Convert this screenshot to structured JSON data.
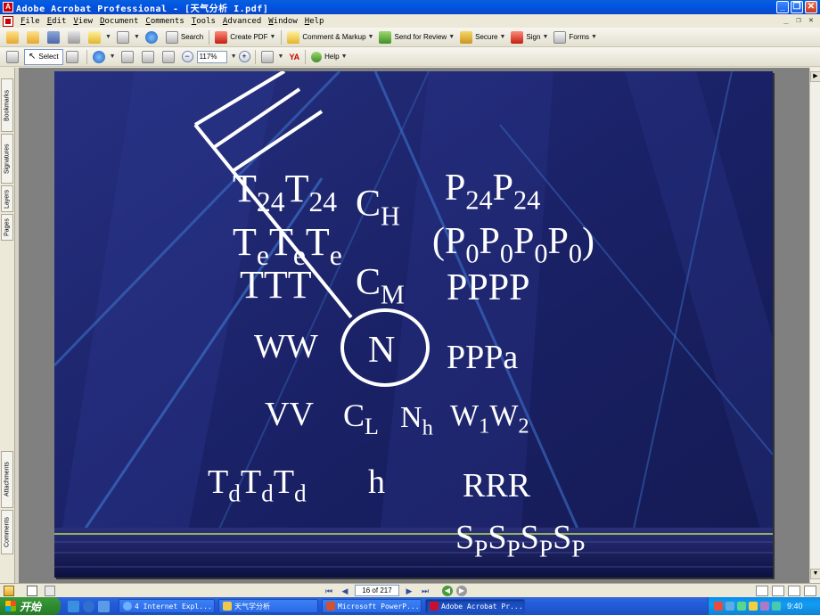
{
  "window": {
    "title": "Adobe Acrobat Professional - [天气分析 I.pdf]",
    "app_icon": "adobe-acrobat-icon"
  },
  "menu": [
    "File",
    "Edit",
    "View",
    "Document",
    "Comments",
    "Tools",
    "Advanced",
    "Window",
    "Help"
  ],
  "toolbar1": {
    "search": "Search",
    "create_pdf": "Create PDF",
    "comment_markup": "Comment & Markup",
    "send_review": "Send for Review",
    "secure": "Secure",
    "sign": "Sign",
    "forms": "Forms"
  },
  "toolbar2": {
    "select": "Select",
    "zoom": "117%",
    "help": "Help"
  },
  "nav_tabs": {
    "bookmarks": "Bookmarks",
    "signatures": "Signatures",
    "layers": "Layers",
    "pages": "Pages",
    "attachments": "Attachments",
    "comments": "Comments"
  },
  "slide": {
    "background": "#1c2366",
    "symbols": {
      "t24": {
        "base": "T",
        "sub": "24",
        "repeat": 2
      },
      "ch": {
        "base": "C",
        "sub": "H"
      },
      "p24": {
        "base": "P",
        "sub": "24",
        "repeat": 2
      },
      "te": {
        "base": "T",
        "sub": "e",
        "repeat": 3
      },
      "p0": {
        "open": "(",
        "base": "P",
        "sub": "0",
        "repeat": 4,
        "close": ")"
      },
      "ttt": "TTT",
      "cm": {
        "base": "C",
        "sub": "M"
      },
      "pppp": "PPPP",
      "ww": "WW",
      "n": "N",
      "pppa": "PPPa",
      "vv": "VV",
      "cl": {
        "base": "C",
        "sub": "L"
      },
      "nh": {
        "base": "N",
        "sub": "h"
      },
      "w1": {
        "base": "W",
        "sub": "1"
      },
      "w2": {
        "base": "W",
        "sub": "2"
      },
      "td": {
        "base": "T",
        "sub": "d",
        "repeat": 3
      },
      "h": "h",
      "rrr": "RRR",
      "sp": {
        "base": "S",
        "sub": "P",
        "repeat": 4
      }
    }
  },
  "status": {
    "page_indicator": "16 of 217"
  },
  "taskbar": {
    "start": "开始",
    "tasks": [
      "4 Internet Expl...",
      "天气学分析",
      "Microsoft PowerP...",
      "Adobe Acrobat Pr..."
    ],
    "clock": "9:40"
  }
}
